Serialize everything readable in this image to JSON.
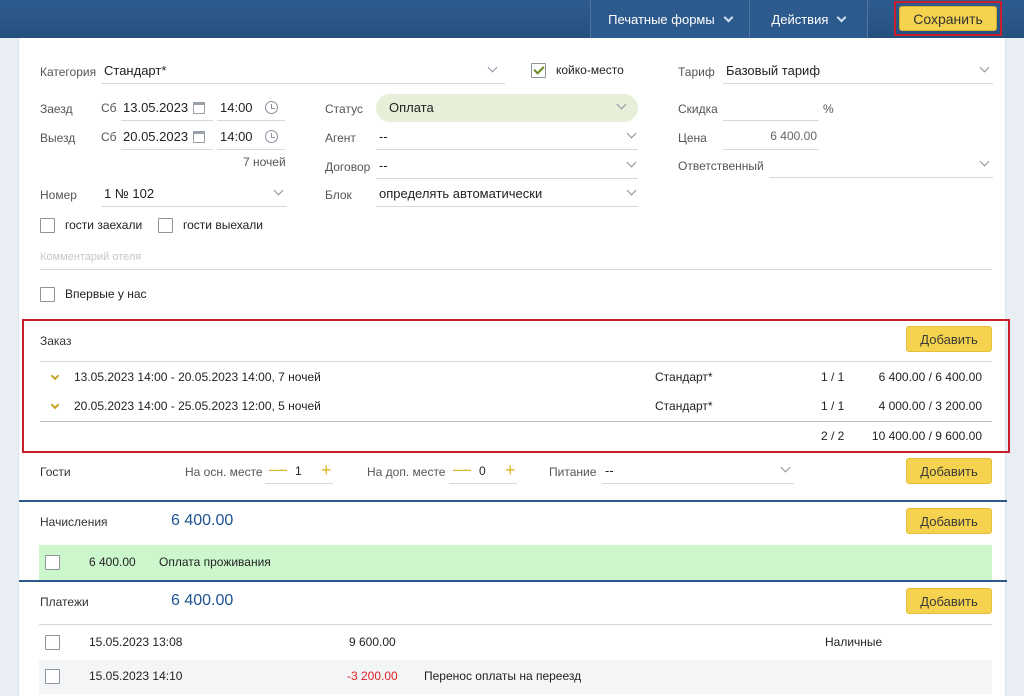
{
  "topbar": {
    "print_forms": "Печатные формы",
    "actions": "Действия",
    "save": "Сохранить"
  },
  "form": {
    "category_label": "Категория",
    "category_value": "Стандарт*",
    "bed_place_label": "койко-место",
    "bed_place_checked": true,
    "tariff_label": "Тариф",
    "tariff_value": "Базовый тариф",
    "checkin_label": "Заезд",
    "checkin_day": "Сб",
    "checkin_date": "13.05.2023",
    "checkin_time": "14:00",
    "checkout_label": "Выезд",
    "checkout_day": "Сб",
    "checkout_date": "20.05.2023",
    "checkout_time": "14:00",
    "nights": "7 ночей",
    "status_label": "Статус",
    "status_value": "Оплата",
    "agent_label": "Агент",
    "agent_value": "--",
    "contract_label": "Договор",
    "contract_value": "--",
    "block_label": "Блок",
    "block_value": "определять автоматически",
    "discount_label": "Скидка",
    "discount_unit": "%",
    "price_label": "Цена",
    "price_value": "6 400.00",
    "responsible_label": "Ответственный",
    "room_label": "Номер",
    "room_value": "1 № 102",
    "guests_checked_in": "гости заехали",
    "guests_checked_out": "гости выехали",
    "hotel_comment_placeholder": "Комментарий отеля",
    "first_time": "Впервые у нас"
  },
  "order": {
    "title": "Заказ",
    "add": "Добавить",
    "rows": [
      {
        "period": "13.05.2023 14:00 - 20.05.2023 14:00, 7 ночей",
        "category": "Стандарт*",
        "count": "1 / 1",
        "amount": "6 400.00 / 6 400.00"
      },
      {
        "period": "20.05.2023 14:00 - 25.05.2023 12:00, 5 ночей",
        "category": "Стандарт*",
        "count": "1 / 1",
        "amount": "4 000.00 / 3 200.00"
      }
    ],
    "total_count": "2 / 2",
    "total_amount": "10 400.00 / 9 600.00"
  },
  "guests": {
    "title": "Гости",
    "main_label": "На осн. месте",
    "main_value": "1",
    "extra_label": "На доп. месте",
    "extra_value": "0",
    "meal_label": "Питание",
    "meal_value": "--",
    "add": "Добавить",
    "minus": "—",
    "plus": "+"
  },
  "charges": {
    "title": "Начисления",
    "total": "6 400.00",
    "add": "Добавить",
    "rows": [
      {
        "amount": "6 400.00",
        "description": "Оплата проживания"
      }
    ]
  },
  "payments": {
    "title": "Платежи",
    "total": "6 400.00",
    "add": "Добавить",
    "rows": [
      {
        "datetime": "15.05.2023 13:08",
        "amount": "9 600.00",
        "note": "",
        "method": "Наличные"
      },
      {
        "datetime": "15.05.2023 14:10",
        "amount": "-3 200.00",
        "note": "Перенос оплаты на переезд",
        "method": ""
      }
    ]
  },
  "colors": {
    "topbar": "#2d5a8d",
    "save_button": "#f6d34f",
    "highlight_border": "#c8202a",
    "status_pill": "#e6f0d9",
    "charge_row": "#ccf7cc",
    "negative": "#dd2222"
  }
}
